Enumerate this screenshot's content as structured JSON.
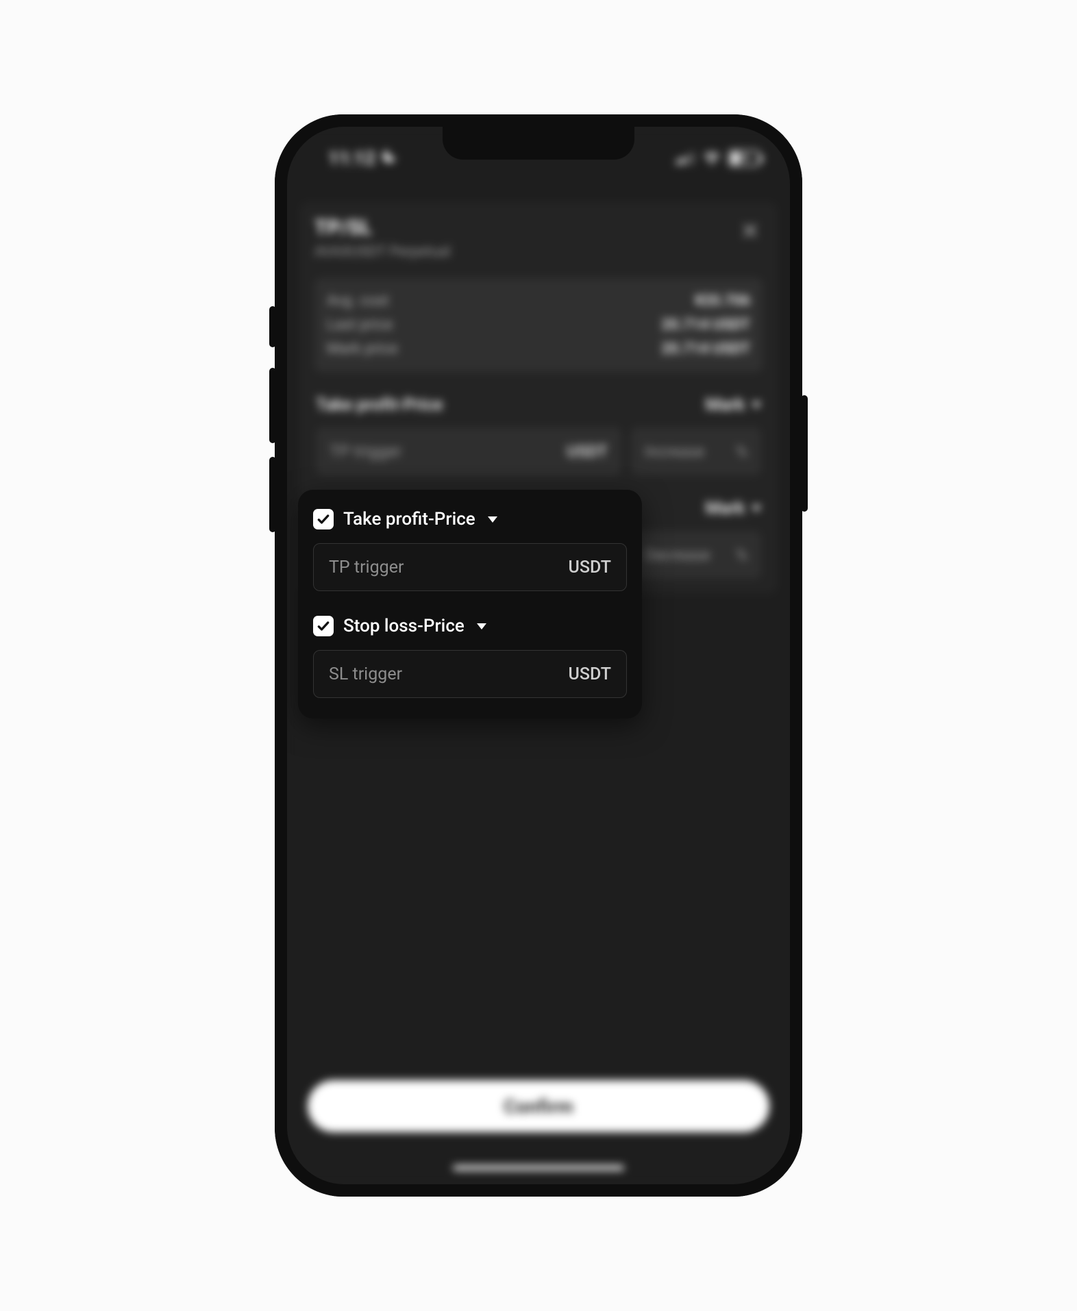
{
  "status": {
    "time": "11:12",
    "battery": "26"
  },
  "modal": {
    "title": "TP/SL",
    "subtitle": "AVAXUSDT Perpetual",
    "info": {
      "avg_cost_label": "Avg. cost",
      "avg_cost_value": "¥20.706",
      "last_price_label": "Last price",
      "last_price_value": "20.714 USDT",
      "mark_price_label": "Mark price",
      "mark_price_value": "20.714 USDT"
    },
    "tp": {
      "title": "Take profit-Price",
      "mark_label": "Mark",
      "trigger_placeholder": "TP trigger",
      "trigger_unit": "USDT",
      "pct_label": "Increase",
      "pct_unit": "%"
    },
    "sl": {
      "title": "Stop loss-Price",
      "mark_label": "Mark",
      "trigger_placeholder": "SL trigger",
      "trigger_unit": "USDT",
      "pct_label": "Decrease",
      "pct_unit": "%"
    },
    "confirm": "Confirm"
  },
  "popover": {
    "tp_label": "Take profit-Price",
    "tp_placeholder": "TP trigger",
    "tp_unit": "USDT",
    "sl_label": "Stop loss-Price",
    "sl_placeholder": "SL trigger",
    "sl_unit": "USDT"
  }
}
